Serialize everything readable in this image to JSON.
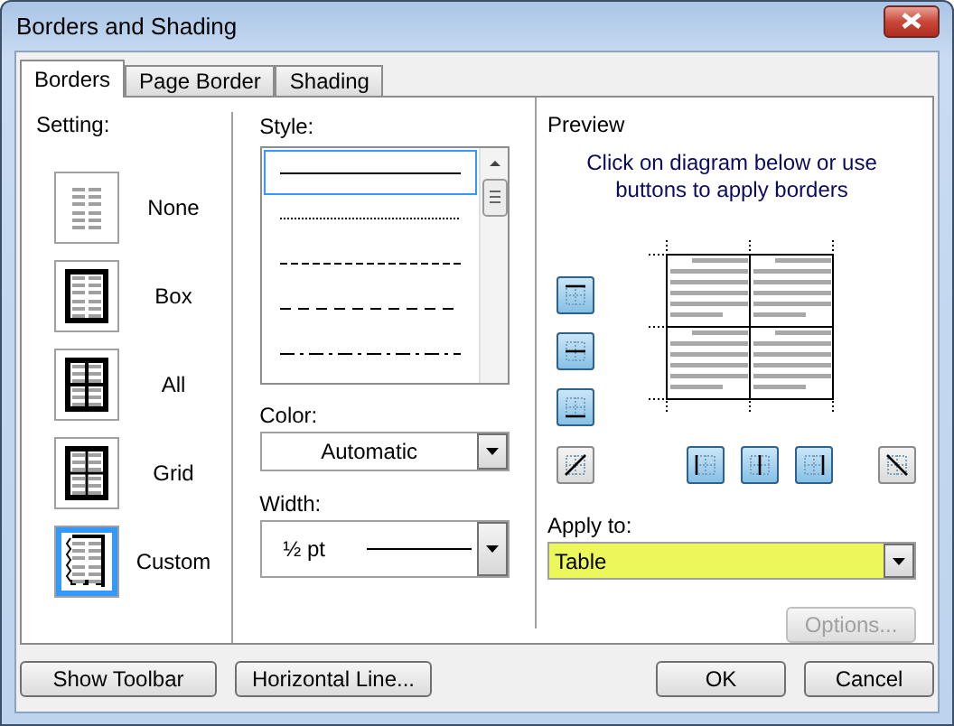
{
  "window": {
    "title": "Borders and Shading"
  },
  "tabs": [
    {
      "label": "Borders",
      "selected": true
    },
    {
      "label": "Page Border",
      "selected": false
    },
    {
      "label": "Shading",
      "selected": false
    }
  ],
  "setting": {
    "label": "Setting:",
    "options": [
      {
        "label": "None",
        "kind": "none",
        "selected": false
      },
      {
        "label": "Box",
        "kind": "box",
        "selected": false
      },
      {
        "label": "All",
        "kind": "all",
        "selected": false
      },
      {
        "label": "Grid",
        "kind": "grid",
        "selected": false
      },
      {
        "label": "Custom",
        "kind": "custom",
        "selected": true
      }
    ]
  },
  "style": {
    "label": "Style:",
    "lines": [
      {
        "kind": "solid",
        "selected": true
      },
      {
        "kind": "dotted",
        "selected": false
      },
      {
        "kind": "dashed-short",
        "selected": false
      },
      {
        "kind": "dashed",
        "selected": false
      },
      {
        "kind": "dash-dot",
        "selected": false
      }
    ]
  },
  "color": {
    "label": "Color:",
    "value": "Automatic"
  },
  "width": {
    "label": "Width:",
    "value": "½ pt"
  },
  "preview": {
    "label": "Preview",
    "hint": "Click on diagram below or use buttons to apply borders",
    "side_buttons": [
      {
        "kind": "top",
        "selected": true
      },
      {
        "kind": "inside-horizontal",
        "selected": true
      },
      {
        "kind": "bottom",
        "selected": true
      }
    ],
    "bottom_buttons": [
      {
        "kind": "diagonal-up",
        "selected": false
      },
      {
        "kind": "left",
        "selected": true
      },
      {
        "kind": "inside-vertical",
        "selected": true
      },
      {
        "kind": "right",
        "selected": true
      },
      {
        "kind": "diagonal-down",
        "selected": false
      }
    ]
  },
  "apply_to": {
    "label": "Apply to:",
    "value": "Table"
  },
  "options_button": {
    "label": "Options...",
    "disabled": true
  },
  "buttons": [
    {
      "label": "Show Toolbar"
    },
    {
      "label": "Horizontal Line..."
    },
    {
      "label": "OK"
    },
    {
      "label": "Cancel"
    }
  ]
}
